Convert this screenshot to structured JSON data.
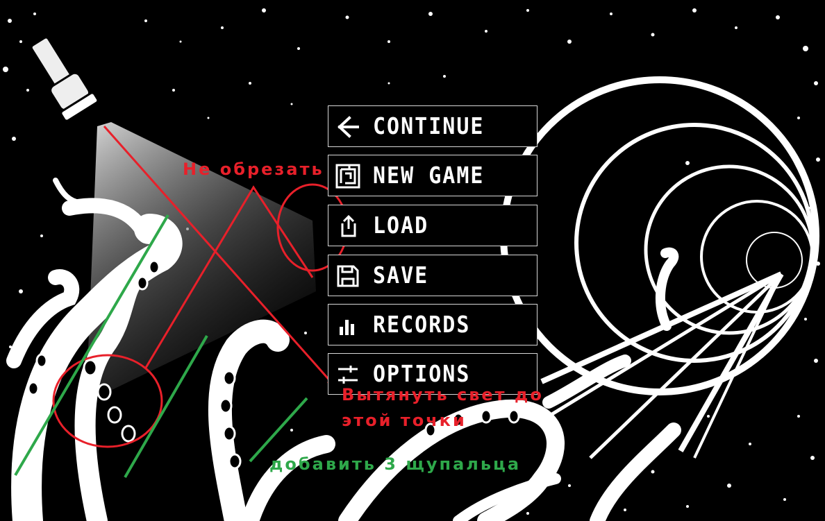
{
  "menu": {
    "items": [
      {
        "label": "CONTINUE",
        "icon": "arrow-left-icon"
      },
      {
        "label": "NEW GAME",
        "icon": "maze-icon"
      },
      {
        "label": "LOAD",
        "icon": "upload-icon"
      },
      {
        "label": "SAVE",
        "icon": "save-floppy-icon"
      },
      {
        "label": "RECORDS",
        "icon": "bar-chart-icon"
      },
      {
        "label": "OPTIONS",
        "icon": "sliders-icon"
      }
    ]
  },
  "annotations": {
    "no_crop": "Не обрезать",
    "extend_light_1": "Вытянуть свет до",
    "extend_light_2": "этой точки",
    "add_tentacles": "добавить 3 щупальца"
  },
  "colors": {
    "background": "#000000",
    "foreground": "#ffffff",
    "annotation_red": "#e8202a",
    "annotation_green": "#2ea84a"
  }
}
